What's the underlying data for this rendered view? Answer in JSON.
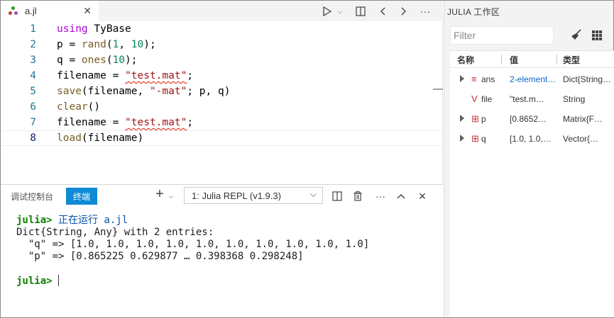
{
  "editor": {
    "tab_name": "a.jl",
    "lines": [
      {
        "n": "1"
      },
      {
        "n": "2"
      },
      {
        "n": "3"
      },
      {
        "n": "4"
      },
      {
        "n": "5"
      },
      {
        "n": "6"
      },
      {
        "n": "7"
      },
      {
        "n": "8"
      }
    ],
    "code": {
      "l1_kw": "using",
      "l1_rest": " TyBase",
      "l2_a": "p = ",
      "l2_fn": "rand",
      "l2_b": "(",
      "l2_n1": "1",
      "l2_c": ", ",
      "l2_n2": "10",
      "l2_d": ");",
      "l3_a": "q = ",
      "l3_fn": "ones",
      "l3_b": "(",
      "l3_n1": "10",
      "l3_d": ");",
      "l4_a": "filename = ",
      "l4_str": "\"test.mat\"",
      "l4_d": ";",
      "l5_fn": "save",
      "l5_a": "(filename, ",
      "l5_str": "\"-mat\"",
      "l5_d": "; p, q)",
      "l6_fn": "clear",
      "l6_d": "()",
      "l7_a": "filename = ",
      "l7_str": "\"test.mat\"",
      "l7_d": ";",
      "l8_fn": "load",
      "l8_d": "(filename)"
    }
  },
  "panel": {
    "tab_debug": "调试控制台",
    "tab_terminal": "终端",
    "plus": "+",
    "terminal_select": "1: Julia REPL (v1.9.3)",
    "terminal": {
      "prompt": "julia>",
      "running": " 正在运行 a.jl",
      "out1": "Dict{String, Any} with 2 entries:",
      "out2": "  \"q\" => [1.0, 1.0, 1.0, 1.0, 1.0, 1.0, 1.0, 1.0, 1.0, 1.0]",
      "out3": "  \"p\" => [0.865225 0.629877 … 0.398368 0.298248]",
      "prompt2": "julia>"
    }
  },
  "sidebar": {
    "title": "JULIA 工作区",
    "filter_placeholder": "Filter",
    "headers": {
      "name": "名称",
      "value": "值",
      "type": "类型"
    },
    "rows": [
      {
        "name": "ans",
        "value": "2-element…",
        "type": "Dict{String…",
        "icon": "≡"
      },
      {
        "name": "file",
        "value": "\"test.m…",
        "type": "String",
        "icon": "V"
      },
      {
        "name": "p",
        "value": "[0.8652…",
        "type": "Matrix{F…",
        "icon": "⊞"
      },
      {
        "name": "q",
        "value": "[1.0, 1.0,…",
        "type": "Vector{…",
        "icon": "⊞"
      }
    ]
  }
}
